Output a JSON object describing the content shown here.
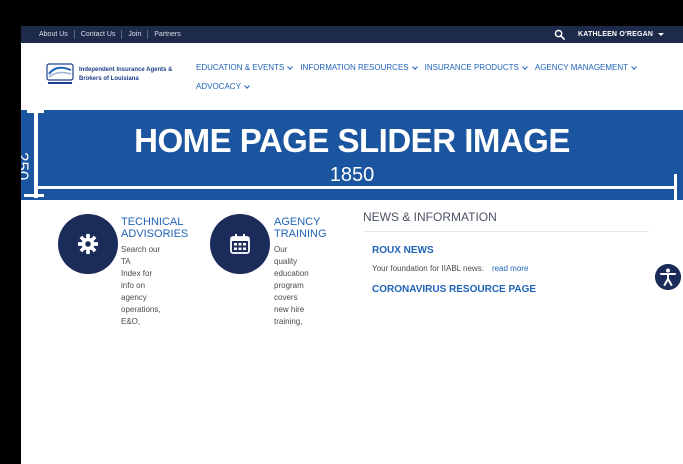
{
  "top_bar": {
    "links": [
      "About Us",
      "Contact Us",
      "Join",
      "Partners"
    ],
    "search_icon": "search-icon",
    "user_name": "KATHLEEN O'REGAN"
  },
  "header": {
    "logo_line1": "Independent Insurance Agents &",
    "logo_line2": "Brokers of Louisiana",
    "nav": [
      "EDUCATION & EVENTS",
      "INFORMATION RESOURCES",
      "INSURANCE PRODUCTS",
      "AGENCY MANAGEMENT",
      "ADVOCACY"
    ]
  },
  "slider": {
    "title": "HOME PAGE SLIDER IMAGE",
    "width_label": "1850",
    "height_label": "250",
    "background": "#1b55a0"
  },
  "features": [
    {
      "icon": "gear-icon",
      "title_line1": "TECHNICAL",
      "title_line2": "ADVISORIES",
      "desc_lines": [
        "Search our TA",
        "Index for info on",
        "agency",
        "operations, E&O,"
      ]
    },
    {
      "icon": "calendar-icon",
      "title_line1": "AGENCY",
      "title_line2": "TRAINING",
      "desc_lines": [
        "Our quality",
        "education",
        "program covers",
        "new hire training,"
      ]
    }
  ],
  "news": {
    "heading": "NEWS & INFORMATION",
    "items": [
      {
        "title": "ROUX NEWS",
        "snippet": "Your foundation for IIABL news.",
        "link": "read more"
      },
      {
        "title": "CORONAVIRUS RESOURCE PAGE"
      }
    ]
  },
  "accessibility_icon": "accessibility-icon"
}
